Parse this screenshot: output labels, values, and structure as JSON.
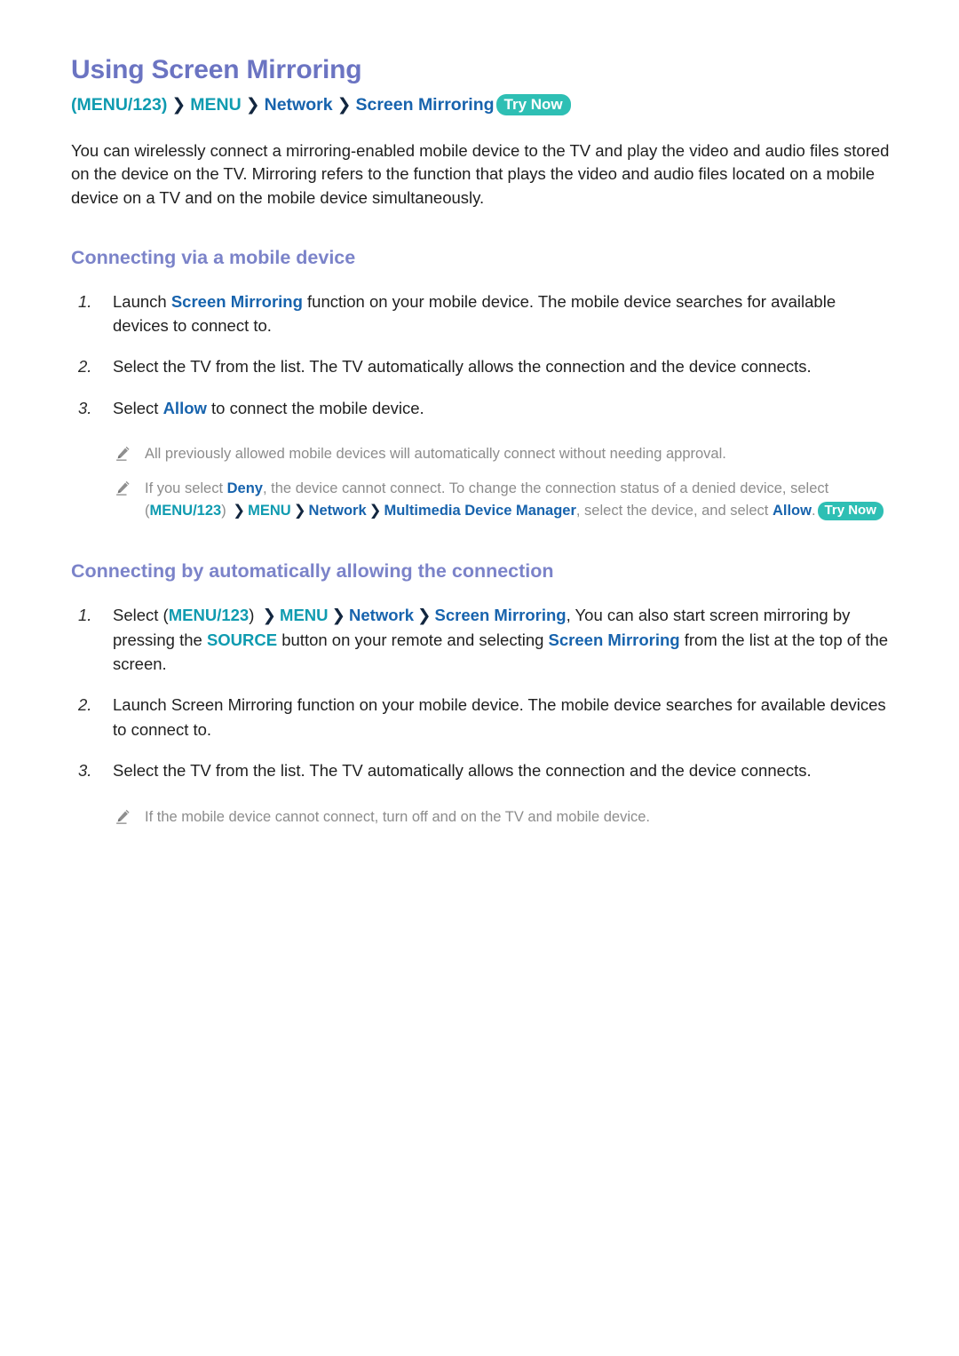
{
  "document": {
    "title": "Using Screen Mirroring",
    "breadcrumb": {
      "menu_123": "(MENU/123)",
      "arrow": "❯",
      "menu": "MENU",
      "network": "Network",
      "screen_mirroring": "Screen Mirroring",
      "try_now": "Try Now"
    },
    "intro": "You can wirelessly connect a mirroring-enabled mobile device to the TV and play the video and audio files stored on the device on the TV. Mirroring refers to the function that plays the video and audio files located on a mobile device on a TV and on the mobile device simultaneously."
  },
  "section1": {
    "heading": "Connecting via a mobile device",
    "steps": [
      {
        "number": "1.",
        "pre": "Launch ",
        "link": "Screen Mirroring",
        "post": " function on your mobile device. The mobile device searches for available devices to connect to."
      },
      {
        "number": "2.",
        "pre": "Select the TV from the list. The TV automatically allows the connection and the device connects.",
        "link": "",
        "post": ""
      },
      {
        "number": "3.",
        "pre": "Select ",
        "link": "Allow",
        "post": " to connect the mobile device."
      }
    ],
    "notes": [
      {
        "icon": "pencil-icon",
        "text": "All previously allowed mobile devices will automatically connect without needing approval."
      },
      {
        "icon": "pencil-icon",
        "p1": "If you select ",
        "deny": "Deny",
        "p2": ", the device cannot connect. To change the connection status of a denied device, select (",
        "menu_123": "MENU/123",
        "p3": ") ",
        "arrow": "❯",
        "menu": "MENU",
        "network": "Network",
        "mdm": "Multimedia Device Manager",
        "p4": ", select the device, and select ",
        "allow": "Allow",
        "p5": ".",
        "try_now": "Try Now"
      }
    ]
  },
  "section2": {
    "heading": "Connecting by automatically allowing the connection",
    "steps": [
      {
        "number": "1.",
        "p1": "Select (",
        "menu_123": "MENU/123",
        "p2": ") ",
        "arrow": "❯",
        "menu": "MENU",
        "network": "Network",
        "screen_mirroring": "Screen Mirroring",
        "p3": ", You can also start screen mirroring by pressing the ",
        "source": "SOURCE",
        "p4": " button on your remote and selecting ",
        "screen_mirroring2": "Screen Mirroring",
        "p5": " from the list at the top of the screen."
      },
      {
        "number": "2.",
        "text": "Launch Screen Mirroring function on your mobile device. The mobile device searches for available devices to connect to."
      },
      {
        "number": "3.",
        "text": "Select the TV from the list. The TV automatically allows the connection and the device connects."
      }
    ],
    "notes": [
      {
        "icon": "pencil-icon",
        "text": "If the mobile device cannot connect, turn off and on the TV and mobile device."
      }
    ]
  },
  "colors": {
    "title": "#6b74c2",
    "heading": "#7b83c9",
    "teal": "#0f9bb0",
    "blue": "#1763ad",
    "badge": "#2ebfb4",
    "note_gray": "#8c8c8c",
    "arrow": "#12263f"
  }
}
